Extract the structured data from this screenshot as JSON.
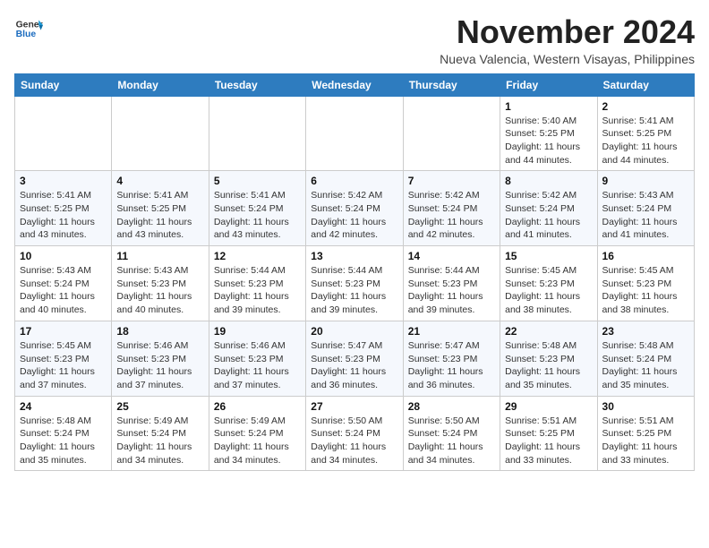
{
  "header": {
    "logo_line1": "General",
    "logo_line2": "Blue",
    "month": "November 2024",
    "location": "Nueva Valencia, Western Visayas, Philippines"
  },
  "weekdays": [
    "Sunday",
    "Monday",
    "Tuesday",
    "Wednesday",
    "Thursday",
    "Friday",
    "Saturday"
  ],
  "weeks": [
    [
      {
        "day": "",
        "info": ""
      },
      {
        "day": "",
        "info": ""
      },
      {
        "day": "",
        "info": ""
      },
      {
        "day": "",
        "info": ""
      },
      {
        "day": "",
        "info": ""
      },
      {
        "day": "1",
        "info": "Sunrise: 5:40 AM\nSunset: 5:25 PM\nDaylight: 11 hours\nand 44 minutes."
      },
      {
        "day": "2",
        "info": "Sunrise: 5:41 AM\nSunset: 5:25 PM\nDaylight: 11 hours\nand 44 minutes."
      }
    ],
    [
      {
        "day": "3",
        "info": "Sunrise: 5:41 AM\nSunset: 5:25 PM\nDaylight: 11 hours\nand 43 minutes."
      },
      {
        "day": "4",
        "info": "Sunrise: 5:41 AM\nSunset: 5:25 PM\nDaylight: 11 hours\nand 43 minutes."
      },
      {
        "day": "5",
        "info": "Sunrise: 5:41 AM\nSunset: 5:24 PM\nDaylight: 11 hours\nand 43 minutes."
      },
      {
        "day": "6",
        "info": "Sunrise: 5:42 AM\nSunset: 5:24 PM\nDaylight: 11 hours\nand 42 minutes."
      },
      {
        "day": "7",
        "info": "Sunrise: 5:42 AM\nSunset: 5:24 PM\nDaylight: 11 hours\nand 42 minutes."
      },
      {
        "day": "8",
        "info": "Sunrise: 5:42 AM\nSunset: 5:24 PM\nDaylight: 11 hours\nand 41 minutes."
      },
      {
        "day": "9",
        "info": "Sunrise: 5:43 AM\nSunset: 5:24 PM\nDaylight: 11 hours\nand 41 minutes."
      }
    ],
    [
      {
        "day": "10",
        "info": "Sunrise: 5:43 AM\nSunset: 5:24 PM\nDaylight: 11 hours\nand 40 minutes."
      },
      {
        "day": "11",
        "info": "Sunrise: 5:43 AM\nSunset: 5:23 PM\nDaylight: 11 hours\nand 40 minutes."
      },
      {
        "day": "12",
        "info": "Sunrise: 5:44 AM\nSunset: 5:23 PM\nDaylight: 11 hours\nand 39 minutes."
      },
      {
        "day": "13",
        "info": "Sunrise: 5:44 AM\nSunset: 5:23 PM\nDaylight: 11 hours\nand 39 minutes."
      },
      {
        "day": "14",
        "info": "Sunrise: 5:44 AM\nSunset: 5:23 PM\nDaylight: 11 hours\nand 39 minutes."
      },
      {
        "day": "15",
        "info": "Sunrise: 5:45 AM\nSunset: 5:23 PM\nDaylight: 11 hours\nand 38 minutes."
      },
      {
        "day": "16",
        "info": "Sunrise: 5:45 AM\nSunset: 5:23 PM\nDaylight: 11 hours\nand 38 minutes."
      }
    ],
    [
      {
        "day": "17",
        "info": "Sunrise: 5:45 AM\nSunset: 5:23 PM\nDaylight: 11 hours\nand 37 minutes."
      },
      {
        "day": "18",
        "info": "Sunrise: 5:46 AM\nSunset: 5:23 PM\nDaylight: 11 hours\nand 37 minutes."
      },
      {
        "day": "19",
        "info": "Sunrise: 5:46 AM\nSunset: 5:23 PM\nDaylight: 11 hours\nand 37 minutes."
      },
      {
        "day": "20",
        "info": "Sunrise: 5:47 AM\nSunset: 5:23 PM\nDaylight: 11 hours\nand 36 minutes."
      },
      {
        "day": "21",
        "info": "Sunrise: 5:47 AM\nSunset: 5:23 PM\nDaylight: 11 hours\nand 36 minutes."
      },
      {
        "day": "22",
        "info": "Sunrise: 5:48 AM\nSunset: 5:23 PM\nDaylight: 11 hours\nand 35 minutes."
      },
      {
        "day": "23",
        "info": "Sunrise: 5:48 AM\nSunset: 5:24 PM\nDaylight: 11 hours\nand 35 minutes."
      }
    ],
    [
      {
        "day": "24",
        "info": "Sunrise: 5:48 AM\nSunset: 5:24 PM\nDaylight: 11 hours\nand 35 minutes."
      },
      {
        "day": "25",
        "info": "Sunrise: 5:49 AM\nSunset: 5:24 PM\nDaylight: 11 hours\nand 34 minutes."
      },
      {
        "day": "26",
        "info": "Sunrise: 5:49 AM\nSunset: 5:24 PM\nDaylight: 11 hours\nand 34 minutes."
      },
      {
        "day": "27",
        "info": "Sunrise: 5:50 AM\nSunset: 5:24 PM\nDaylight: 11 hours\nand 34 minutes."
      },
      {
        "day": "28",
        "info": "Sunrise: 5:50 AM\nSunset: 5:24 PM\nDaylight: 11 hours\nand 34 minutes."
      },
      {
        "day": "29",
        "info": "Sunrise: 5:51 AM\nSunset: 5:25 PM\nDaylight: 11 hours\nand 33 minutes."
      },
      {
        "day": "30",
        "info": "Sunrise: 5:51 AM\nSunset: 5:25 PM\nDaylight: 11 hours\nand 33 minutes."
      }
    ]
  ]
}
